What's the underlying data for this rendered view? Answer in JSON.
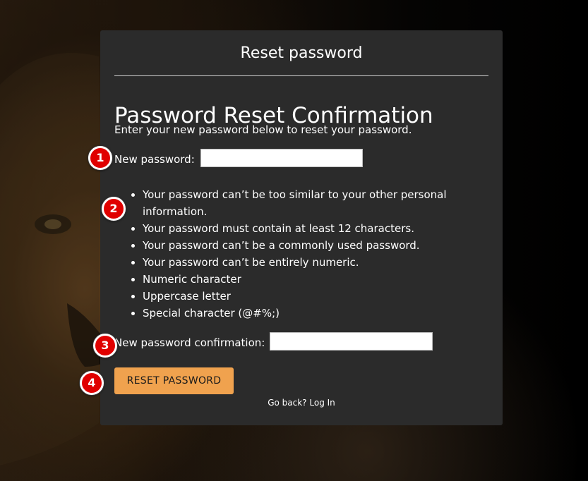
{
  "page": {
    "card_title": "Reset password",
    "heading": "Password Reset Confirmation",
    "intro": "Enter your new password below to reset your password."
  },
  "form": {
    "new_password_label": "New password:",
    "new_password_value": "",
    "confirmation_label": "New password confirmation:",
    "confirmation_value": "",
    "submit_label": "RESET PASSWORD"
  },
  "rules": [
    "Your password can’t be too similar to your other personal information.",
    "Your password must contain at least 12 characters.",
    "Your password can’t be a commonly used password.",
    "Your password can’t be entirely numeric.",
    "Numeric character",
    "Uppercase letter",
    "Special character (@#%;)"
  ],
  "footer": {
    "back_text": "Go back?",
    "login_link": "Log In"
  },
  "annotations": [
    "1",
    "2",
    "3",
    "4"
  ],
  "colors": {
    "card_background": "#2b2b2b",
    "button_background": "#f0a24e",
    "marker_fill": "#e00000"
  }
}
